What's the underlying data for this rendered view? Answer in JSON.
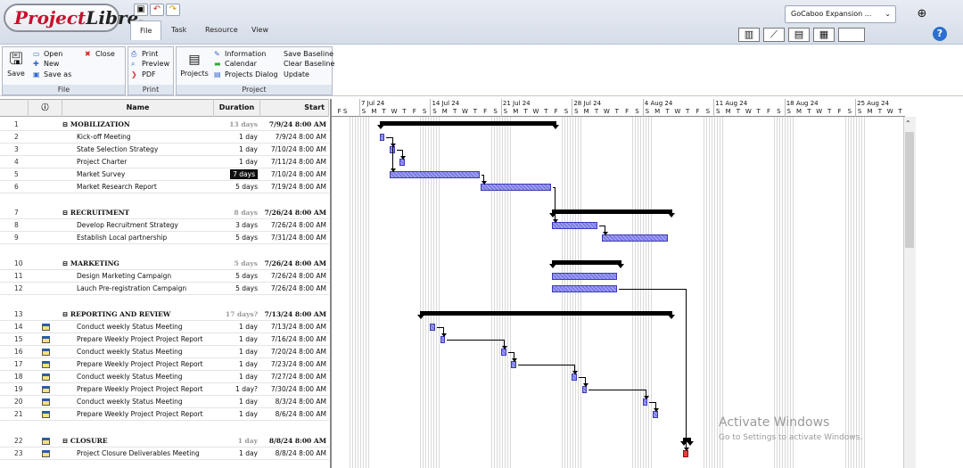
{
  "app": {
    "logo": "ProjectLibre",
    "project_selector": "GoCaboo Expansion ...",
    "tabs": [
      "File",
      "Task",
      "Resource",
      "View"
    ],
    "active_tab": "File"
  },
  "ribbon": {
    "file_group": {
      "label": "File",
      "save": "Save",
      "open": "Open",
      "new": "New",
      "save_as": "Save as",
      "close": "Close"
    },
    "print_group": {
      "label": "Print",
      "print": "Print",
      "preview": "Preview",
      "pdf": "PDF"
    },
    "project_group": {
      "label": "Project",
      "projects": "Projects",
      "information": "Information",
      "calendar": "Calendar",
      "projects_dialog": "Projects Dialog",
      "save_baseline": "Save Baseline",
      "clear_baseline": "Clear Baseline",
      "update": "Update"
    }
  },
  "table": {
    "headers": {
      "indicator": "ⓘ",
      "name": "Name",
      "duration": "Duration",
      "start": "Start"
    },
    "rows": [
      {
        "id": "1",
        "name": "⊟ MOBILIZATION",
        "duration": "13 days",
        "start": "7/9/24 8:00 AM",
        "summary": true
      },
      {
        "id": "2",
        "name": "Kick-off Meeting",
        "duration": "1 day",
        "start": "7/9/24 8:00 AM"
      },
      {
        "id": "3",
        "name": "State Selection Strategy",
        "duration": "1 day",
        "start": "7/10/24 8:00 AM"
      },
      {
        "id": "4",
        "name": "Project Charter",
        "duration": "1 day",
        "start": "7/11/24 8:00 AM"
      },
      {
        "id": "5",
        "name": "Market Survey",
        "duration": "7 days",
        "start": "7/10/24 8:00 AM",
        "editing": true
      },
      {
        "id": "6",
        "name": "Market Research Report",
        "duration": "5 days",
        "start": "7/19/24 8:00 AM"
      },
      {
        "id": "7",
        "name": "⊟ RECRUITMENT",
        "duration": "8 days",
        "start": "7/26/24 8:00 AM",
        "summary": true
      },
      {
        "id": "8",
        "name": "Develop Recruitment Strategy",
        "duration": "3 days",
        "start": "7/26/24 8:00 AM"
      },
      {
        "id": "9",
        "name": "Establish Local partnership",
        "duration": "5 days",
        "start": "7/31/24 8:00 AM"
      },
      {
        "id": "10",
        "name": "⊟ MARKETING",
        "duration": "5 days",
        "start": "7/26/24 8:00 AM",
        "summary": true
      },
      {
        "id": "11",
        "name": "Design Marketing Campaign",
        "duration": "5 days",
        "start": "7/26/24 8:00 AM"
      },
      {
        "id": "12",
        "name": "Lauch Pre-registration Campaign",
        "duration": "5 days",
        "start": "7/26/24 8:00 AM"
      },
      {
        "id": "13",
        "name": "⊟ REPORTING AND REVIEW",
        "duration": "17 days?",
        "start": "7/13/24 8:00 AM",
        "summary": true
      },
      {
        "id": "14",
        "name": "Conduct weekly Status Meeting",
        "duration": "1 day",
        "start": "7/13/24 8:00 AM",
        "cal": true
      },
      {
        "id": "15",
        "name": "Prepare Weekly Project Project Report",
        "duration": "1 day",
        "start": "7/16/24 8:00 AM",
        "cal": true
      },
      {
        "id": "16",
        "name": "Conduct weekly Status Meeting",
        "duration": "1 day",
        "start": "7/20/24 8:00 AM",
        "cal": true
      },
      {
        "id": "17",
        "name": "Prepare Weekly Project Project Report",
        "duration": "1 day",
        "start": "7/23/24 8:00 AM",
        "cal": true
      },
      {
        "id": "18",
        "name": "Conduct weekly Status Meeting",
        "duration": "1 day",
        "start": "7/27/24 8:00 AM",
        "cal": true
      },
      {
        "id": "19",
        "name": "Prepare Weekly Project Project Report",
        "duration": "1 day?",
        "start": "7/30/24 8:00 AM",
        "cal": true
      },
      {
        "id": "20",
        "name": "Conduct weekly Status Meeting",
        "duration": "1 day",
        "start": "8/3/24 8:00 AM",
        "cal": true
      },
      {
        "id": "21",
        "name": "Prepare Weekly Project Project Report",
        "duration": "1 day",
        "start": "8/6/24 8:00 AM",
        "cal": true
      },
      {
        "id": "22",
        "name": "⊟ CLOSURE",
        "duration": "1 day",
        "start": "8/8/24 8:00 AM",
        "summary": true,
        "cal": true
      },
      {
        "id": "23",
        "name": "Project Closure Deliverables Meeting",
        "duration": "1 day",
        "start": "8/8/24 8:00 AM",
        "cal": true
      }
    ]
  },
  "gantt": {
    "weeks": [
      "7 Jul 24",
      "14 Jul 24",
      "21 Jul 24",
      "28 Jul 24",
      "4 Aug 24",
      "11 Aug 24",
      "18 Aug 24",
      "25 Aug 24"
    ],
    "first_day_label": "F S",
    "day_letters": [
      "S",
      "M",
      "T",
      "W",
      "T",
      "F",
      "S"
    ]
  },
  "watermark": {
    "title": "Activate Windows",
    "subtitle": "Go to Settings to activate Windows."
  }
}
